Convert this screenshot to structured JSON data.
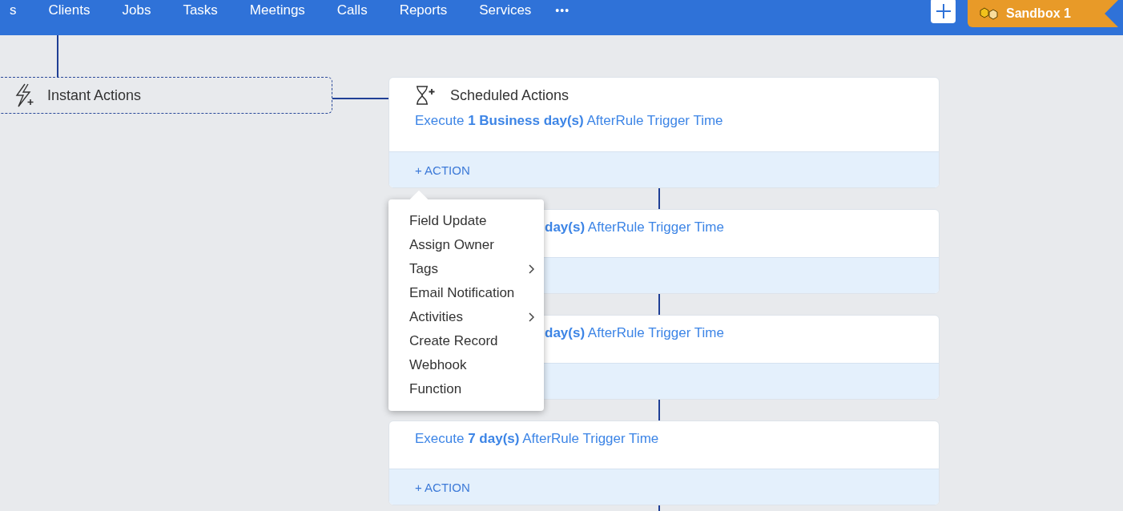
{
  "nav": {
    "items": [
      {
        "label": "s"
      },
      {
        "label": "Clients"
      },
      {
        "label": "Jobs"
      },
      {
        "label": "Tasks"
      },
      {
        "label": "Meetings"
      },
      {
        "label": "Calls"
      },
      {
        "label": "Reports"
      },
      {
        "label": "Services"
      }
    ],
    "more": "•••",
    "sandbox": "Sandbox 1"
  },
  "instant_actions": {
    "title": "Instant Actions"
  },
  "scheduled_actions": {
    "title": "Scheduled Actions",
    "cards": [
      {
        "text": "Execute **1 Business day(s)** AfterRule Trigger Time",
        "action": "+ ACTION"
      },
      {
        "text": "**day(s)** AfterRule Trigger Time"
      },
      {
        "text": "**day(s)** AfterRule Trigger Time"
      },
      {
        "text": "Execute **7 day(s)** AfterRule Trigger Time",
        "action": "+ ACTION"
      }
    ]
  },
  "action_menu": {
    "items": [
      {
        "label": "Field Update",
        "submenu": false
      },
      {
        "label": "Assign Owner",
        "submenu": false
      },
      {
        "label": "Tags",
        "submenu": true
      },
      {
        "label": "Email Notification",
        "submenu": false
      },
      {
        "label": "Activities",
        "submenu": true
      },
      {
        "label": "Create Record",
        "submenu": false
      },
      {
        "label": "Webhook",
        "submenu": false
      },
      {
        "label": "Function",
        "submenu": false
      }
    ]
  }
}
